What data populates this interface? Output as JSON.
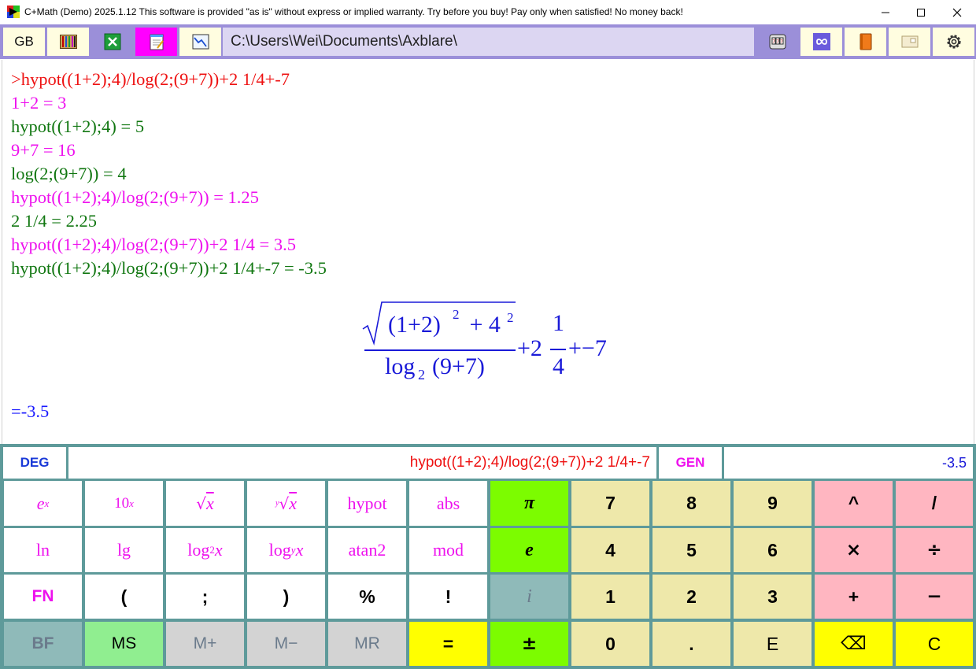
{
  "window": {
    "title": "C+Math (Demo) 2025.1.12 This software is provided \"as is\" without express or implied warranty. Try before you buy! Pay only when satisfied! No money back!",
    "minimize": "—",
    "maximize": "☐",
    "close": "✕"
  },
  "toolbar": {
    "lang": "GB",
    "path": "C:\\Users\\Wei\\Documents\\Axblare\\"
  },
  "output": {
    "lines": [
      ">hypot((1+2);4)/log(2;(9+7))+2 1/4+-7",
      "1+2 = 3",
      "hypot((1+2);4) = 5",
      "9+7 = 16",
      "log(2;(9+7)) = 4",
      "hypot((1+2);4)/log(2;(9+7)) = 1.25",
      "2 1/4 = 2.25",
      "hypot((1+2);4)/log(2;(9+7))+2 1/4 = 3.5",
      "hypot((1+2);4)/log(2;(9+7))+2 1/4+-7 = -3.5"
    ],
    "result": "=-3.5",
    "formula": {
      "num_open": "(1+2)",
      "num_exp1": "2",
      "num_plus": " + 4",
      "num_exp2": "2",
      "den_log": "log",
      "den_sub": "2",
      "den_arg": "(9+7)",
      "tail_plus": "+2",
      "frac_num": "1",
      "frac_den": "4",
      "tail_rest": "+−7"
    }
  },
  "input": {
    "angle_mode": "DEG",
    "expression": "hypot((1+2);4)/log(2;(9+7))+2 1/4+-7",
    "format_mode": "GEN",
    "result": "-3.5"
  },
  "keys": {
    "exp": "e",
    "exp_sup": "x",
    "pow10": "10",
    "pow10_sup": "x",
    "sqrt_x": "x",
    "root_y": "y",
    "root_x": "x",
    "hypot": "hypot",
    "abs": "abs",
    "pi": "π",
    "k7": "7",
    "k8": "8",
    "k9": "9",
    "caret": "^",
    "slash": "/",
    "ln": "ln",
    "lg": "lg",
    "log2": "log",
    "log2_sub": "2",
    "log2_x": "x",
    "logy": "log",
    "logy_sub": "y",
    "logy_x": "x",
    "atan2": "atan2",
    "mod": "mod",
    "e": "e",
    "k4": "4",
    "k5": "5",
    "k6": "6",
    "times": "×",
    "divide": "÷",
    "fn": "FN",
    "lparen": "(",
    "semicolon": ";",
    "rparen": ")",
    "percent": "%",
    "factorial": "!",
    "imag": "i",
    "k1": "1",
    "k2": "2",
    "k3": "3",
    "plus": "+",
    "minus": "−",
    "bf": "BF",
    "ms": "MS",
    "mplus": "M+",
    "mminus": "M−",
    "mr": "MR",
    "equals": "=",
    "plusminus": "±",
    "k0": "0",
    "dot": ".",
    "E": "E",
    "backspace": "⌫",
    "clear": "C"
  }
}
